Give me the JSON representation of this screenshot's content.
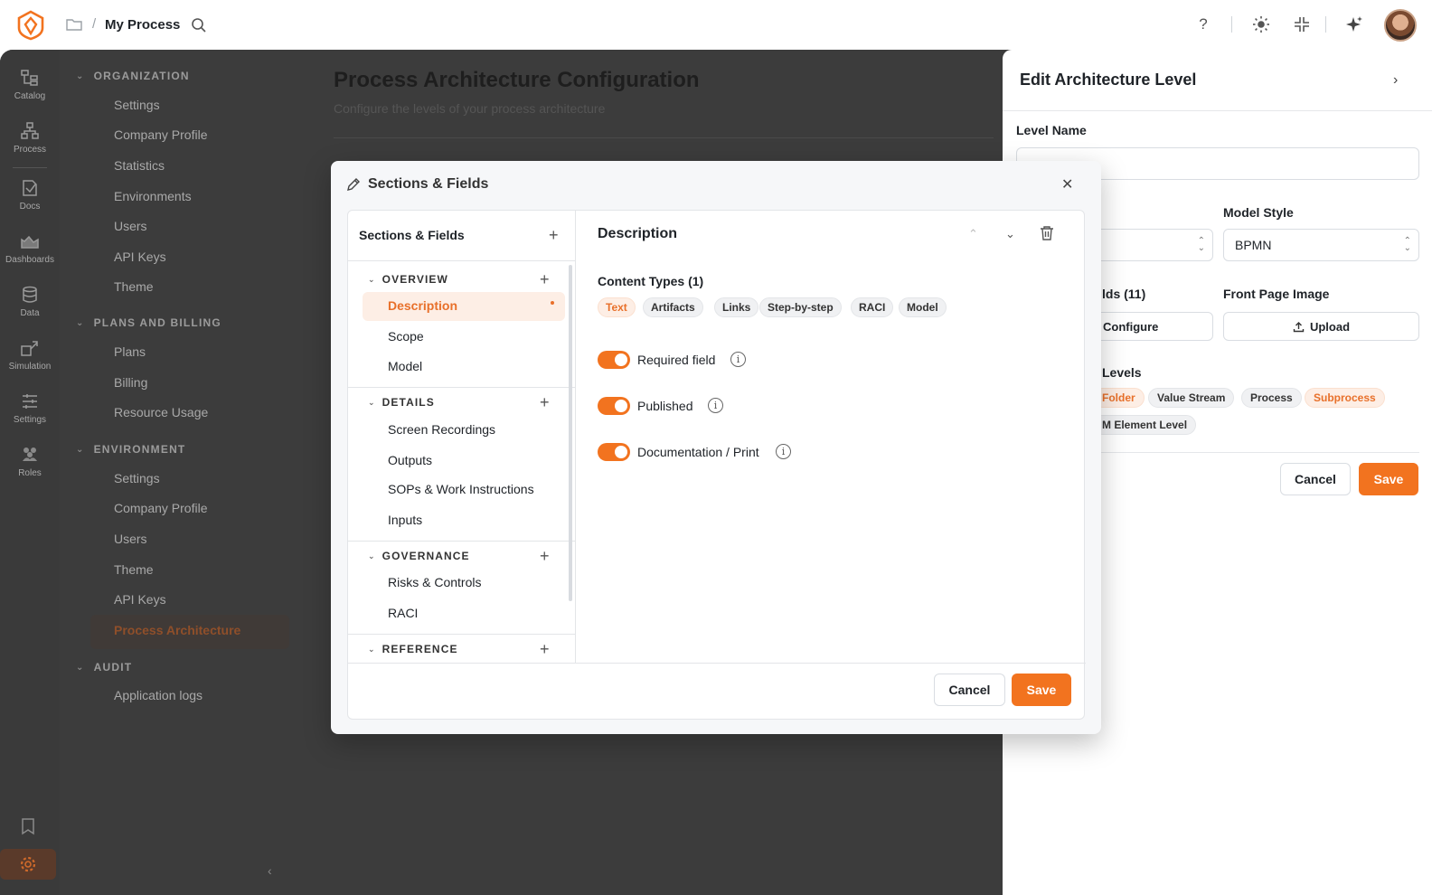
{
  "topbar": {
    "title": "My Process",
    "separator": "/"
  },
  "rail": [
    {
      "label": "Catalog",
      "icon": "catalog-icon"
    },
    {
      "label": "Process",
      "icon": "process-icon"
    },
    {
      "label": "Docs",
      "icon": "docs-icon"
    },
    {
      "label": "Dashboards",
      "icon": "dashboards-icon"
    },
    {
      "label": "Data",
      "icon": "data-icon"
    },
    {
      "label": "Simulation",
      "icon": "simulation-icon"
    },
    {
      "label": "Settings",
      "icon": "settings-sliders-icon"
    },
    {
      "label": "Roles",
      "icon": "roles-icon"
    }
  ],
  "settings_nav": {
    "groups": [
      {
        "title": "ORGANIZATION",
        "items": [
          "Settings",
          "Company Profile",
          "Statistics",
          "Environments",
          "Users",
          "API Keys",
          "Theme"
        ]
      },
      {
        "title": "PLANS AND BILLING",
        "items": [
          "Plans",
          "Billing",
          "Resource Usage"
        ]
      },
      {
        "title": "ENVIRONMENT",
        "items": [
          "Settings",
          "Company Profile",
          "Users",
          "Theme",
          "API Keys",
          "Process Architecture"
        ]
      },
      {
        "title": "AUDIT",
        "items": [
          "Application logs"
        ]
      }
    ],
    "active_item": "Process Architecture"
  },
  "main": {
    "title": "Process Architecture Configuration",
    "subtitle": "Configure the levels of your process architecture"
  },
  "drawer": {
    "title": "Edit Architecture Level",
    "level_name_label": "Level Name",
    "level_name_value": "",
    "model_style_label": "Model Style",
    "model_style_value": "BPMN",
    "fields_label": "lds (11)",
    "configure_label": "Configure",
    "front_page_label": "Front Page Image",
    "upload_label": "Upload",
    "levels_label": "Levels",
    "level_chips": [
      {
        "label": "Folder",
        "active": true
      },
      {
        "label": "Value Stream",
        "active": false
      },
      {
        "label": "Process",
        "active": false
      },
      {
        "label": "Subprocess",
        "active": true
      },
      {
        "label": "M Element Level",
        "active": false
      }
    ],
    "cancel_label": "Cancel",
    "save_label": "Save"
  },
  "modal": {
    "title": "Sections & Fields",
    "left_header": "Sections & Fields",
    "groups": [
      {
        "title": "OVERVIEW",
        "items": [
          "Description",
          "Scope",
          "Model"
        ]
      },
      {
        "title": "DETAILS",
        "items": [
          "Screen Recordings",
          "Outputs",
          "SOPs & Work Instructions",
          "Inputs"
        ]
      },
      {
        "title": "GOVERNANCE",
        "items": [
          "Risks & Controls",
          "RACI"
        ]
      },
      {
        "title": "REFERENCE",
        "items": []
      }
    ],
    "active_item": "Description",
    "detail": {
      "title": "Description",
      "content_types_label": "Content Types (1)",
      "content_types": [
        {
          "label": "Text",
          "active": true
        },
        {
          "label": "Artifacts",
          "active": false
        },
        {
          "label": "Links",
          "active": false
        },
        {
          "label": "Step-by-step",
          "active": false
        },
        {
          "label": "RACI",
          "active": false
        },
        {
          "label": "Model",
          "active": false
        }
      ],
      "toggles": [
        {
          "label": "Required field",
          "on": true
        },
        {
          "label": "Published",
          "on": true
        },
        {
          "label": "Documentation / Print",
          "on": true
        }
      ]
    },
    "cancel_label": "Cancel",
    "save_label": "Save"
  },
  "colors": {
    "accent": "#f2731f",
    "accent_light": "#fdeee5",
    "overlay": "#3c3c3c"
  }
}
